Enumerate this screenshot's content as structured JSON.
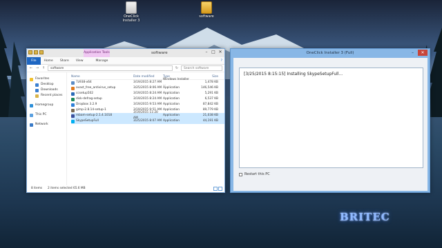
{
  "desktop": {
    "icons": [
      {
        "label": "OneClick Installer 3"
      },
      {
        "label": "software"
      }
    ],
    "watermark": "BRITEC"
  },
  "explorer": {
    "app_tools_label": "Application Tools",
    "title": "software",
    "ribbon_tabs": [
      "File",
      "Home",
      "Share",
      "View",
      "Manage"
    ],
    "address": "software",
    "search_placeholder": "Search software",
    "nav": {
      "favorites": "Favorites",
      "desktop": "Desktop",
      "downloads": "Downloads",
      "recent": "Recent places",
      "homegroup": "Homegroup",
      "thispc": "This PC",
      "network": "Network"
    },
    "columns": [
      "Name",
      "Date modified",
      "Type",
      "Size"
    ],
    "files": [
      {
        "name": "7z938-x64",
        "date": "3/19/2015 8:27 AM",
        "type": "Windows Installer ...",
        "size": "1,478 KB",
        "icon_color": "#5b8cc6"
      },
      {
        "name": "avast_free_antivirus_setup",
        "date": "3/25/2015 8:06 AM",
        "type": "Application",
        "size": "146,546 KB",
        "icon_color": "#e07a1f"
      },
      {
        "name": "ccsetup502",
        "date": "3/19/2015 8:24 AM",
        "type": "Application",
        "size": "5,291 KB",
        "icon_color": "#2a6bb8"
      },
      {
        "name": "disk-defrag-setup",
        "date": "3/19/2015 8:24 AM",
        "type": "Application",
        "size": "6,537 KB",
        "icon_color": "#1e8a5c"
      },
      {
        "name": "Dropbox 3.2.9",
        "date": "3/19/2015 9:53 AM",
        "type": "Application",
        "size": "87,842 KB",
        "icon_color": "#2d7fd8"
      },
      {
        "name": "gimp-2.8.14-setup-1",
        "date": "3/19/2015 9:51 AM",
        "type": "Application",
        "size": "89,779 KB",
        "icon_color": "#7a6a52"
      },
      {
        "name": "mbam-setup-2.1.4.1018",
        "date": "3/19/2015 11:20 AM",
        "type": "Application",
        "size": "21,038 KB",
        "icon_color": "#3a4f9a"
      },
      {
        "name": "SkypeSetupFull",
        "date": "3/25/2015 8:07 AM",
        "type": "Application",
        "size": "44,191 KB",
        "icon_color": "#00aff0"
      }
    ],
    "status": {
      "items": "8 items",
      "selected": "2 items selected 65.6 MB"
    }
  },
  "installer": {
    "title": "OneClick Installer 3 (Full)",
    "log_text": "[3/25/2015 8:15:15] Installing SkypeSetupFull...",
    "restart_label": "Restart this PC"
  }
}
